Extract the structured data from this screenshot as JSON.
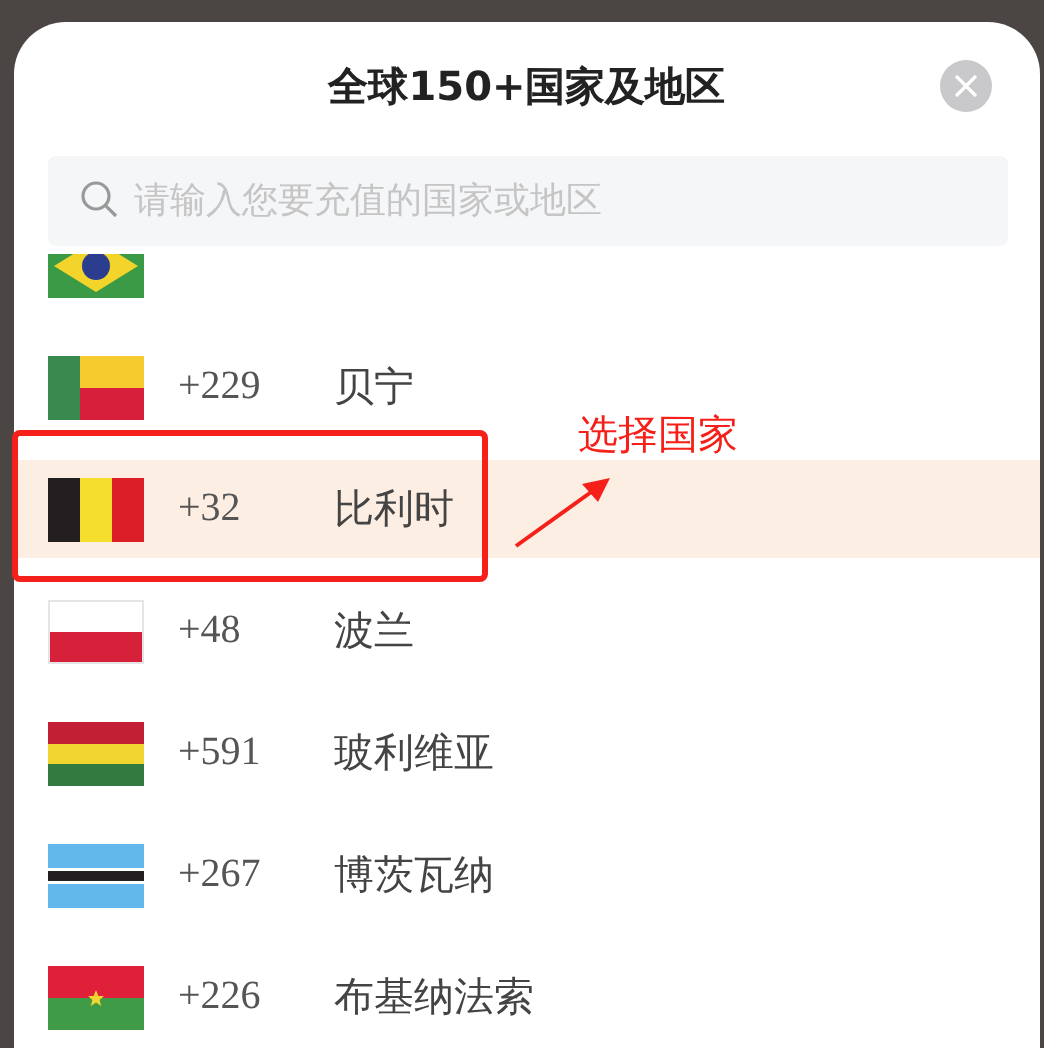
{
  "sheet": {
    "title": "全球150+国家及地区",
    "search": {
      "placeholder": "请输入您要充值的国家或地区"
    }
  },
  "countries": [
    {
      "kind": "brazil",
      "selected": false
    },
    {
      "kind": "benin",
      "code": "+229",
      "name": "贝宁",
      "selected": false
    },
    {
      "kind": "belgium",
      "code": "+32",
      "name": "比利时",
      "selected": true
    },
    {
      "kind": "poland",
      "code": "+48",
      "name": "波兰",
      "selected": false
    },
    {
      "kind": "bolivia",
      "code": "+591",
      "name": "玻利维亚",
      "selected": false
    },
    {
      "kind": "botswana",
      "code": "+267",
      "name": "博茨瓦纳",
      "selected": false
    },
    {
      "kind": "burkina",
      "code": "+226",
      "name": "布基纳法索",
      "selected": false
    }
  ],
  "annotation": {
    "text": "选择国家"
  }
}
